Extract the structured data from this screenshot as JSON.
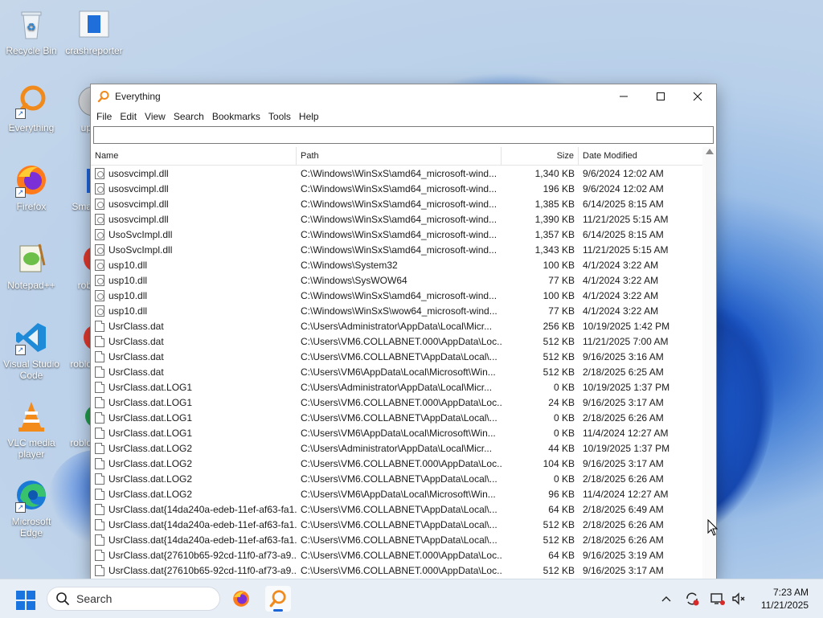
{
  "desktop": {
    "icons": [
      {
        "label": "Recycle Bin"
      },
      {
        "label": "crashreporter"
      },
      {
        "label": "Everything"
      },
      {
        "label": "up"
      },
      {
        "label": "Firefox"
      },
      {
        "label": "Sma"
      },
      {
        "label": "Notepad++"
      },
      {
        "label": "rob"
      },
      {
        "label": "Visual Studio Code"
      },
      {
        "label": "roblo"
      },
      {
        "label": "VLC media player"
      },
      {
        "label": "roblo"
      },
      {
        "label": "Microsoft Edge"
      }
    ]
  },
  "window": {
    "title": "Everything",
    "menu": [
      "File",
      "Edit",
      "View",
      "Search",
      "Bookmarks",
      "Tools",
      "Help"
    ],
    "search_value": "",
    "columns": {
      "name": "Name",
      "path": "Path",
      "size": "Size",
      "date": "Date Modified"
    },
    "rows": [
      {
        "name": "usosvcimpl.dll",
        "path": "C:\\Windows\\WinSxS\\amd64_microsoft-wind...",
        "size": "1,340 KB",
        "date": "9/6/2024 12:02 AM",
        "icon": "dll"
      },
      {
        "name": "usosvcimpl.dll",
        "path": "C:\\Windows\\WinSxS\\amd64_microsoft-wind...",
        "size": "196 KB",
        "date": "9/6/2024 12:02 AM",
        "icon": "dll"
      },
      {
        "name": "usosvcimpl.dll",
        "path": "C:\\Windows\\WinSxS\\amd64_microsoft-wind...",
        "size": "1,385 KB",
        "date": "6/14/2025 8:15 AM",
        "icon": "dll"
      },
      {
        "name": "usosvcimpl.dll",
        "path": "C:\\Windows\\WinSxS\\amd64_microsoft-wind...",
        "size": "1,390 KB",
        "date": "11/21/2025 5:15 AM",
        "icon": "dll"
      },
      {
        "name": "UsoSvcImpl.dll",
        "path": "C:\\Windows\\WinSxS\\amd64_microsoft-wind...",
        "size": "1,357 KB",
        "date": "6/14/2025 8:15 AM",
        "icon": "dll"
      },
      {
        "name": "UsoSvcImpl.dll",
        "path": "C:\\Windows\\WinSxS\\amd64_microsoft-wind...",
        "size": "1,343 KB",
        "date": "11/21/2025 5:15 AM",
        "icon": "dll"
      },
      {
        "name": "usp10.dll",
        "path": "C:\\Windows\\System32",
        "size": "100 KB",
        "date": "4/1/2024 3:22 AM",
        "icon": "dll"
      },
      {
        "name": "usp10.dll",
        "path": "C:\\Windows\\SysWOW64",
        "size": "77 KB",
        "date": "4/1/2024 3:22 AM",
        "icon": "dll"
      },
      {
        "name": "usp10.dll",
        "path": "C:\\Windows\\WinSxS\\amd64_microsoft-wind...",
        "size": "100 KB",
        "date": "4/1/2024 3:22 AM",
        "icon": "dll"
      },
      {
        "name": "usp10.dll",
        "path": "C:\\Windows\\WinSxS\\wow64_microsoft-wind...",
        "size": "77 KB",
        "date": "4/1/2024 3:22 AM",
        "icon": "dll"
      },
      {
        "name": "UsrClass.dat",
        "path": "C:\\Users\\Administrator\\AppData\\Local\\Micr...",
        "size": "256 KB",
        "date": "10/19/2025 1:42 PM",
        "icon": "dat"
      },
      {
        "name": "UsrClass.dat",
        "path": "C:\\Users\\VM6.COLLABNET.000\\AppData\\Loc...",
        "size": "512 KB",
        "date": "11/21/2025 7:00 AM",
        "icon": "dat"
      },
      {
        "name": "UsrClass.dat",
        "path": "C:\\Users\\VM6.COLLABNET\\AppData\\Local\\...",
        "size": "512 KB",
        "date": "9/16/2025 3:16 AM",
        "icon": "dat"
      },
      {
        "name": "UsrClass.dat",
        "path": "C:\\Users\\VM6\\AppData\\Local\\Microsoft\\Win...",
        "size": "512 KB",
        "date": "2/18/2025 6:25 AM",
        "icon": "dat"
      },
      {
        "name": "UsrClass.dat.LOG1",
        "path": "C:\\Users\\Administrator\\AppData\\Local\\Micr...",
        "size": "0 KB",
        "date": "10/19/2025 1:37 PM",
        "icon": "dat"
      },
      {
        "name": "UsrClass.dat.LOG1",
        "path": "C:\\Users\\VM6.COLLABNET.000\\AppData\\Loc...",
        "size": "24 KB",
        "date": "9/16/2025 3:17 AM",
        "icon": "dat"
      },
      {
        "name": "UsrClass.dat.LOG1",
        "path": "C:\\Users\\VM6.COLLABNET\\AppData\\Local\\...",
        "size": "0 KB",
        "date": "2/18/2025 6:26 AM",
        "icon": "dat"
      },
      {
        "name": "UsrClass.dat.LOG1",
        "path": "C:\\Users\\VM6\\AppData\\Local\\Microsoft\\Win...",
        "size": "0 KB",
        "date": "11/4/2024 12:27 AM",
        "icon": "dat"
      },
      {
        "name": "UsrClass.dat.LOG2",
        "path": "C:\\Users\\Administrator\\AppData\\Local\\Micr...",
        "size": "44 KB",
        "date": "10/19/2025 1:37 PM",
        "icon": "dat"
      },
      {
        "name": "UsrClass.dat.LOG2",
        "path": "C:\\Users\\VM6.COLLABNET.000\\AppData\\Loc...",
        "size": "104 KB",
        "date": "9/16/2025 3:17 AM",
        "icon": "dat"
      },
      {
        "name": "UsrClass.dat.LOG2",
        "path": "C:\\Users\\VM6.COLLABNET\\AppData\\Local\\...",
        "size": "0 KB",
        "date": "2/18/2025 6:26 AM",
        "icon": "dat"
      },
      {
        "name": "UsrClass.dat.LOG2",
        "path": "C:\\Users\\VM6\\AppData\\Local\\Microsoft\\Win...",
        "size": "96 KB",
        "date": "11/4/2024 12:27 AM",
        "icon": "dat"
      },
      {
        "name": "UsrClass.dat{14da240a-edeb-11ef-af63-fa1...",
        "path": "C:\\Users\\VM6.COLLABNET\\AppData\\Local\\...",
        "size": "64 KB",
        "date": "2/18/2025 6:49 AM",
        "icon": "dat"
      },
      {
        "name": "UsrClass.dat{14da240a-edeb-11ef-af63-fa1...",
        "path": "C:\\Users\\VM6.COLLABNET\\AppData\\Local\\...",
        "size": "512 KB",
        "date": "2/18/2025 6:26 AM",
        "icon": "dat"
      },
      {
        "name": "UsrClass.dat{14da240a-edeb-11ef-af63-fa1...",
        "path": "C:\\Users\\VM6.COLLABNET\\AppData\\Local\\...",
        "size": "512 KB",
        "date": "2/18/2025 6:26 AM",
        "icon": "dat"
      },
      {
        "name": "UsrClass.dat{27610b65-92cd-11f0-af73-a9...",
        "path": "C:\\Users\\VM6.COLLABNET.000\\AppData\\Loc...",
        "size": "64 KB",
        "date": "9/16/2025 3:19 AM",
        "icon": "dat"
      },
      {
        "name": "UsrClass.dat{27610b65-92cd-11f0-af73-a9...",
        "path": "C:\\Users\\VM6.COLLABNET.000\\AppData\\Loc...",
        "size": "512 KB",
        "date": "9/16/2025 3:17 AM",
        "icon": "dat"
      }
    ]
  },
  "taskbar": {
    "search_placeholder": "Search",
    "time": "7:23 AM",
    "date": "11/21/2025",
    "accent": "#1a66d8"
  }
}
